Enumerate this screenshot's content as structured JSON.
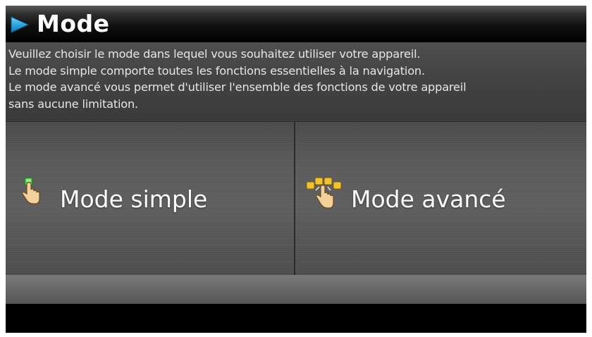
{
  "header": {
    "title": "Mode",
    "icon": "play-arrow-icon",
    "arrow_color": "#2aa7e0"
  },
  "description": {
    "lines": [
      "Veuillez choisir le mode dans lequel vous souhaitez utiliser votre appareil.",
      "Le mode simple comporte toutes les fonctions essentielles à la navigation.",
      "Le mode avancé vous permet d'utiliser l'ensemble des fonctions de votre appareil",
      "sans aucune limitation."
    ]
  },
  "modes": {
    "simple": {
      "label": "Mode simple",
      "icon": "hand-pointer-single-icon"
    },
    "advanced": {
      "label": "Mode avancé",
      "icon": "hand-pointer-multi-icon"
    }
  }
}
